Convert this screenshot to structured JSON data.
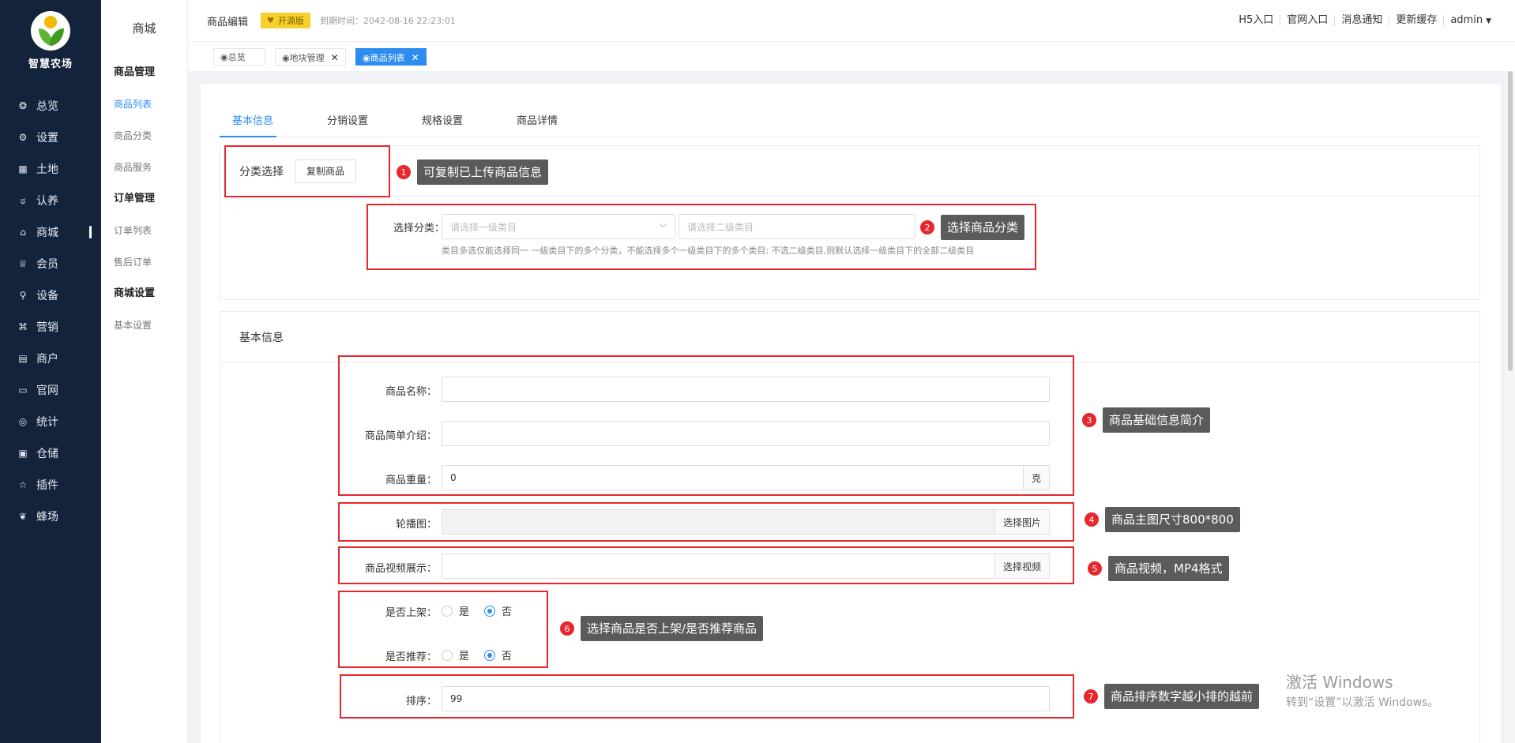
{
  "brand": {
    "name": "智慧农场"
  },
  "nav": {
    "items": [
      {
        "label": "总览",
        "icon": "dashboard-icon",
        "glyph": "❂"
      },
      {
        "label": "设置",
        "icon": "gear-icon",
        "glyph": "⚙"
      },
      {
        "label": "土地",
        "icon": "grid-icon",
        "glyph": "▦"
      },
      {
        "label": "认养",
        "icon": "paw-icon",
        "glyph": "ಠ"
      },
      {
        "label": "商城",
        "icon": "shop-icon",
        "glyph": "⌂"
      },
      {
        "label": "会员",
        "icon": "member-icon",
        "glyph": "♕"
      },
      {
        "label": "设备",
        "icon": "device-icon",
        "glyph": "⚲"
      },
      {
        "label": "营销",
        "icon": "marketing-icon",
        "glyph": "⌘"
      },
      {
        "label": "商户",
        "icon": "merchant-icon",
        "glyph": "▤"
      },
      {
        "label": "官网",
        "icon": "website-icon",
        "glyph": "▭"
      },
      {
        "label": "统计",
        "icon": "stats-icon",
        "glyph": "◎"
      },
      {
        "label": "仓储",
        "icon": "storage-icon",
        "glyph": "▣"
      },
      {
        "label": "插件",
        "icon": "star-icon",
        "glyph": "☆"
      },
      {
        "label": "蜂场",
        "icon": "bee-icon",
        "glyph": "❦"
      }
    ]
  },
  "subnav": {
    "title": "商城",
    "groups": [
      {
        "title": "商品管理",
        "items": [
          "商品列表",
          "商品分类",
          "商品服务"
        ]
      },
      {
        "title": "订单管理",
        "items": [
          "订单列表",
          "售后订单"
        ]
      },
      {
        "title": "商城设置",
        "items": [
          "基本设置"
        ]
      }
    ]
  },
  "header": {
    "title": "商品编辑",
    "badge": "开源版",
    "expire": "到期时间：2042-08-16 22:23:01",
    "links": [
      "H5入口",
      "官网入口",
      "消息通知",
      "更新缓存"
    ],
    "user": "admin"
  },
  "tabs": [
    {
      "label": "◉总览"
    },
    {
      "label": "◉地块管理",
      "close": "✕"
    },
    {
      "label": "◉商品列表",
      "close": "✕"
    }
  ],
  "content_tabs": [
    "基本信息",
    "分销设置",
    "规格设置",
    "商品详情"
  ],
  "category": {
    "heading": "分类选择",
    "copy_button": "复制商品",
    "label": "选择分类：",
    "placeholder1": "请选择一级类目",
    "placeholder2": "请选择二级类目",
    "hint": "类目多选仅能选择同一 一级类目下的多个分类，不能选择多个一级类目下的多个类目; 不选二级类目,则默认选择一级类目下的全部二级类目"
  },
  "basic": {
    "heading": "基本信息",
    "name_label": "商品名称：",
    "intro_label": "商品简单介绍：",
    "weight_label": "商品重量：",
    "weight_value": "0",
    "weight_unit": "克",
    "carousel_label": "轮播图：",
    "carousel_button": "选择图片",
    "video_label": "商品视频展示：",
    "video_button": "选择视频",
    "onsale_label": "是否上架：",
    "recommend_label": "是否推荐：",
    "yes": "是",
    "no": "否",
    "onsale_value": "否",
    "recommend_value": "否",
    "sort_label": "排序：",
    "sort_value": "99"
  },
  "callouts": [
    {
      "num": "1",
      "text": "可复制已上传商品信息"
    },
    {
      "num": "2",
      "text": "选择商品分类"
    },
    {
      "num": "3",
      "text": "商品基础信息简介"
    },
    {
      "num": "4",
      "text": "商品主图尺寸800*800"
    },
    {
      "num": "5",
      "text": "商品视频，MP4格式"
    },
    {
      "num": "6",
      "text": "选择商品是否上架/是否推荐商品"
    },
    {
      "num": "7",
      "text": "商品排序数字越小排的越前"
    }
  ],
  "watermark": {
    "line1": "激活 Windows",
    "line2": "转到“设置”以激活 Windows。"
  },
  "colors": {
    "sidebar": "#13233c",
    "accent": "#2d8cf0",
    "annotation": "#e8262d",
    "badge": "#f7d12b"
  }
}
